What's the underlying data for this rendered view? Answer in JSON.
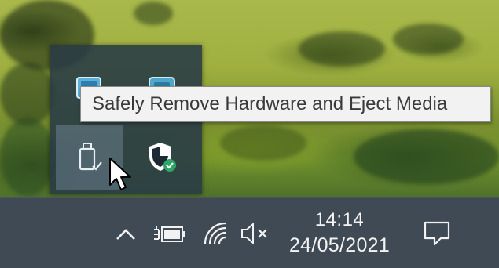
{
  "tray_flyout": {
    "icons": [
      {
        "name": "intel-graphics-icon"
      },
      {
        "name": "display-settings-icon"
      },
      {
        "name": "usb-drive-icon"
      },
      {
        "name": "windows-security-icon"
      }
    ]
  },
  "tooltip": {
    "text": "Safely Remove Hardware and Eject Media"
  },
  "taskbar": {
    "time": "14:14",
    "date": "24/05/2021"
  },
  "colors": {
    "taskbar_bg": "#3f4a55",
    "tooltip_bg": "#f2f2f2",
    "security_green": "#2fa56a"
  }
}
